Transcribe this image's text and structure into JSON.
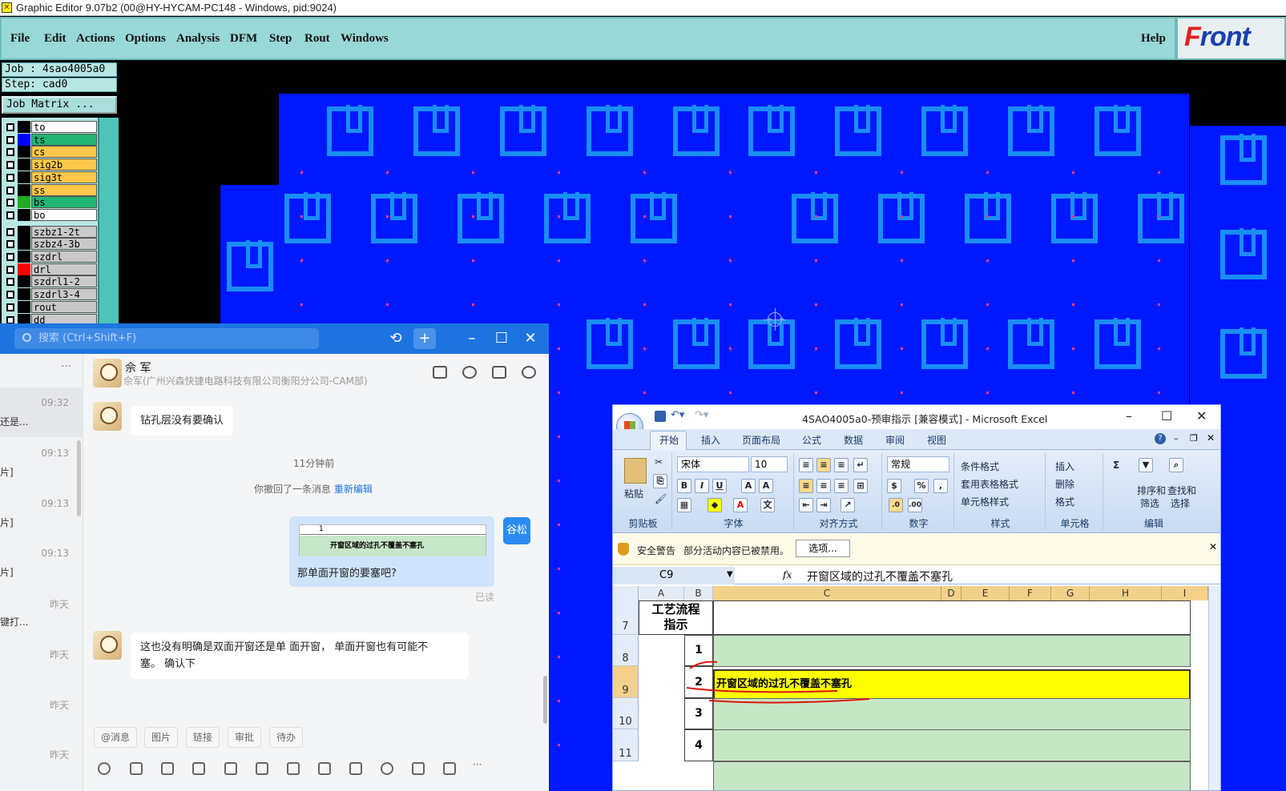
{
  "ge": {
    "title": "Graphic Editor 9.07b2 (00@HY-HYCAM-PC148 - Windows, pid:9024)",
    "menu": [
      "File",
      "Edit",
      "Actions",
      "Options",
      "Analysis",
      "DFM",
      "Step",
      "Rout",
      "Windows"
    ],
    "help": "Help",
    "logo": "Front",
    "job": "Job : 4sao4005a0",
    "step": "Step: cad0",
    "job_matrix": "Job Matrix ...",
    "layers": [
      {
        "name": "to",
        "color": "#ffffff",
        "swatch": "#000000"
      },
      {
        "name": "ts",
        "color": "#22b573",
        "swatch": "#0000ff"
      },
      {
        "name": "cs",
        "color": "#ffc84a",
        "swatch": "#000000"
      },
      {
        "name": "sig2b",
        "color": "#ffc84a",
        "swatch": "#000000"
      },
      {
        "name": "sig3t",
        "color": "#ffc84a",
        "swatch": "#000000"
      },
      {
        "name": "ss",
        "color": "#ffc84a",
        "swatch": "#000000"
      },
      {
        "name": "bs",
        "color": "#22b573",
        "swatch": "#22aa22"
      },
      {
        "name": "bo",
        "color": "#ffffff",
        "swatch": "#000000"
      },
      {
        "name": "szbz1-2t",
        "color": "#c9c9c9",
        "swatch": "#000000"
      },
      {
        "name": "szbz4-3b",
        "color": "#c9c9c9",
        "swatch": "#000000"
      },
      {
        "name": "szdrl",
        "color": "#c9c9c9",
        "swatch": "#000000"
      },
      {
        "name": "drl",
        "color": "#c9c9c9",
        "swatch": "#ff0000"
      },
      {
        "name": "szdrl1-2",
        "color": "#c9c9c9",
        "swatch": "#000000"
      },
      {
        "name": "szdrl3-4",
        "color": "#c9c9c9",
        "swatch": "#000000"
      },
      {
        "name": "rout",
        "color": "#c9c9c9",
        "swatch": "#000000"
      },
      {
        "name": "dd",
        "color": "#c9c9c9",
        "swatch": "#000000"
      }
    ]
  },
  "chat": {
    "search_placeholder": "搜索 (Ctrl+Shift+F)",
    "list": [
      {
        "time": "09:32",
        "snippet": "还是..."
      },
      {
        "time": "09:13",
        "snippet": "片]"
      },
      {
        "time": "09:13",
        "snippet": "片]"
      },
      {
        "time": "09:13",
        "snippet": "片]"
      },
      {
        "time": "昨天",
        "snippet": "键打..."
      },
      {
        "time": "昨天",
        "snippet": ""
      },
      {
        "time": "昨天",
        "snippet": ""
      },
      {
        "time": "昨天",
        "snippet": ""
      }
    ],
    "contact_name": "佘 军",
    "contact_sub": "佘军(广州兴森快捷电路科技有限公司衡阳分公司-CAM部)",
    "msg1": "钻孔层没有要确认",
    "sys_time": "11分钟前",
    "sys_recall": "你撤回了一条消息",
    "sys_reedit": "重新编辑",
    "quote_row1": "1",
    "quote_row2_num": "2",
    "quote_row2_text": "开窗区域的过孔不覆盖不塞孔",
    "my_msg": "那单面开窗的要塞吧?",
    "my_avatar": "谷松",
    "read": "已读",
    "msg2_line1": "这也没有明确是双面开窗还是单 面开窗，  单面开窗也有可能不",
    "msg2_line2": "塞。 确认下",
    "quick": [
      "@消息",
      "图片",
      "链接",
      "审批",
      "待办"
    ]
  },
  "excel": {
    "title": "4SAO4005a0-预审指示 [兼容模式] - Microsoft Excel",
    "tabs": [
      "开始",
      "插入",
      "页面布局",
      "公式",
      "数据",
      "审阅",
      "视图"
    ],
    "font": "宋体",
    "size": "10",
    "number_format": "常规",
    "groups": [
      "剪贴板",
      "字体",
      "对齐方式",
      "数字",
      "样式",
      "单元格",
      "编辑"
    ],
    "paste": "粘贴",
    "style_btns": [
      "条件格式",
      "套用表格格式",
      "单元格样式"
    ],
    "cell_btns": [
      "插入",
      "删除",
      "格式"
    ],
    "edit_btns": [
      "排序和",
      "筛选",
      "查找和",
      "选择"
    ],
    "warn_title": "安全警告",
    "warn_msg": "部分活动内容已被禁用。",
    "warn_btn": "选项...",
    "name_box": "C9",
    "fx": "fx",
    "formula": "开窗区域的过孔不覆盖不塞孔",
    "cols": [
      "A",
      "B",
      "C",
      "D",
      "E",
      "F",
      "G",
      "H",
      "I"
    ],
    "rows": [
      "7",
      "8",
      "9",
      "10",
      "11"
    ],
    "header_cell": "工艺流程指示",
    "nums": [
      "1",
      "2",
      "3",
      "4"
    ],
    "c9": "开窗区域的过孔不覆盖不塞孔"
  }
}
